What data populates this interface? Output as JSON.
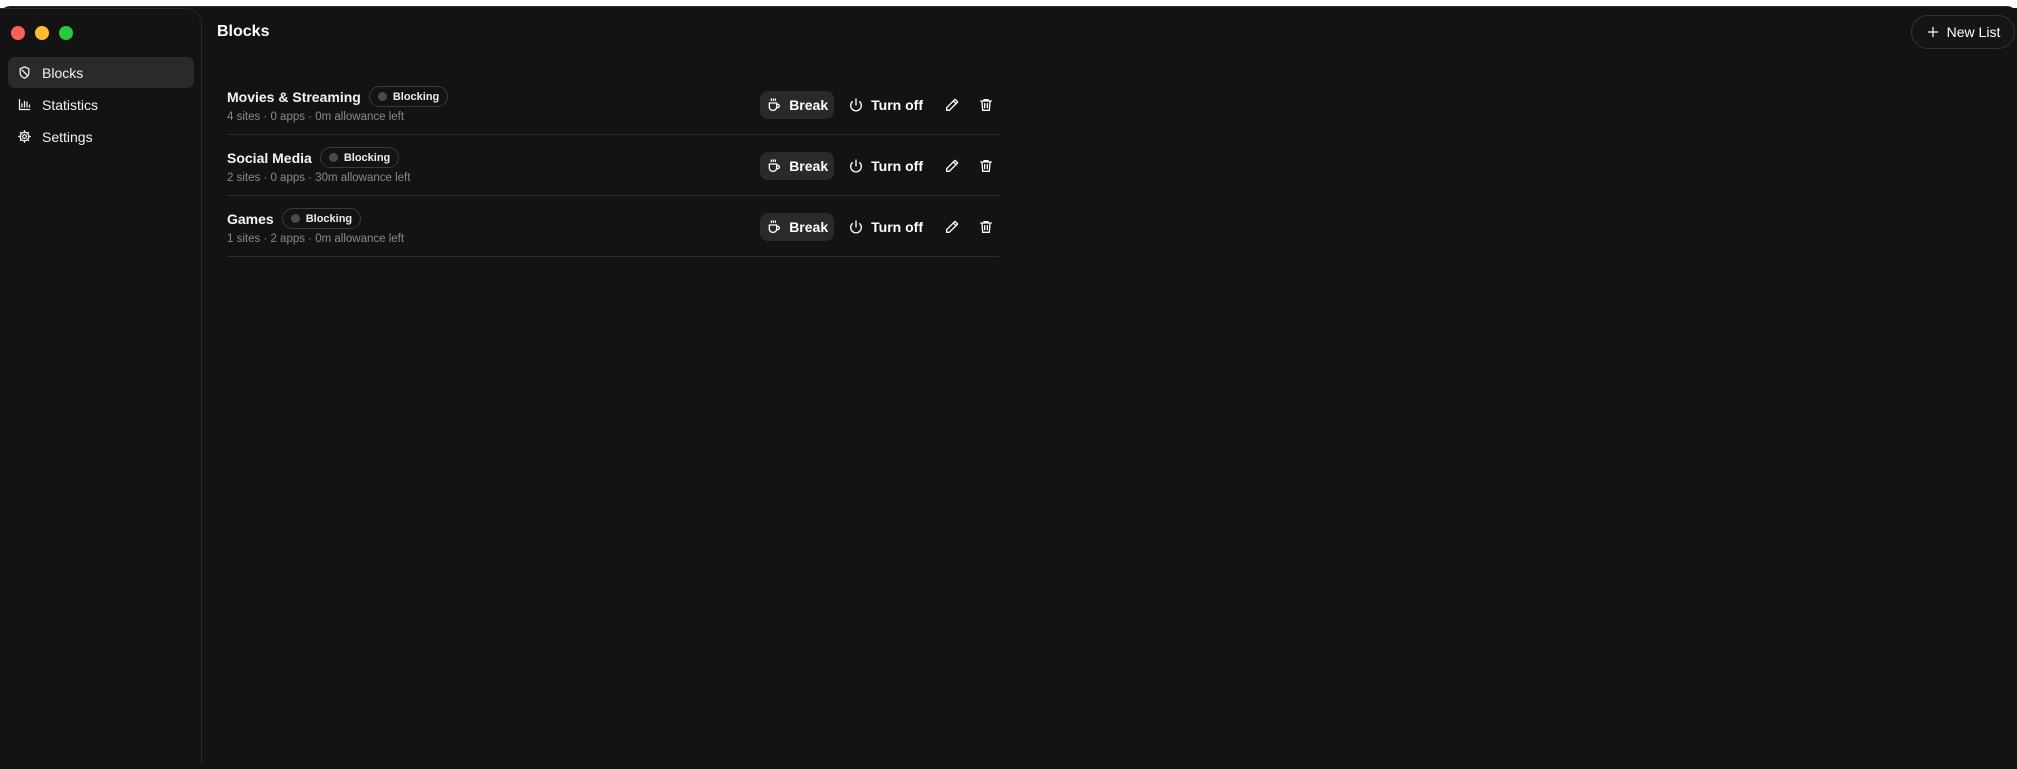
{
  "sidebar": {
    "items": [
      {
        "label": "Blocks",
        "icon": "shield-icon",
        "active": true
      },
      {
        "label": "Statistics",
        "icon": "bar-chart-icon",
        "active": false
      },
      {
        "label": "Settings",
        "icon": "gear-icon",
        "active": false
      }
    ]
  },
  "header": {
    "title": "Blocks",
    "new_list_label": "New List"
  },
  "block_lists": [
    {
      "name": "Movies & Streaming",
      "status": "Blocking",
      "meta": "4 sites · 0 apps · 0m allowance left",
      "break_label": "Break",
      "turn_off_label": "Turn off"
    },
    {
      "name": "Social Media",
      "status": "Blocking",
      "meta": "2 sites · 0 apps · 30m allowance left",
      "break_label": "Break",
      "turn_off_label": "Turn off"
    },
    {
      "name": "Games",
      "status": "Blocking",
      "meta": "1 sites · 2 apps · 0m allowance left",
      "break_label": "Break",
      "turn_off_label": "Turn off"
    }
  ],
  "colors": {
    "background": "#131313",
    "active_nav": "#2a2a2a",
    "close": "#ff5f57",
    "minimize": "#febc2e",
    "maximize": "#28c840"
  }
}
